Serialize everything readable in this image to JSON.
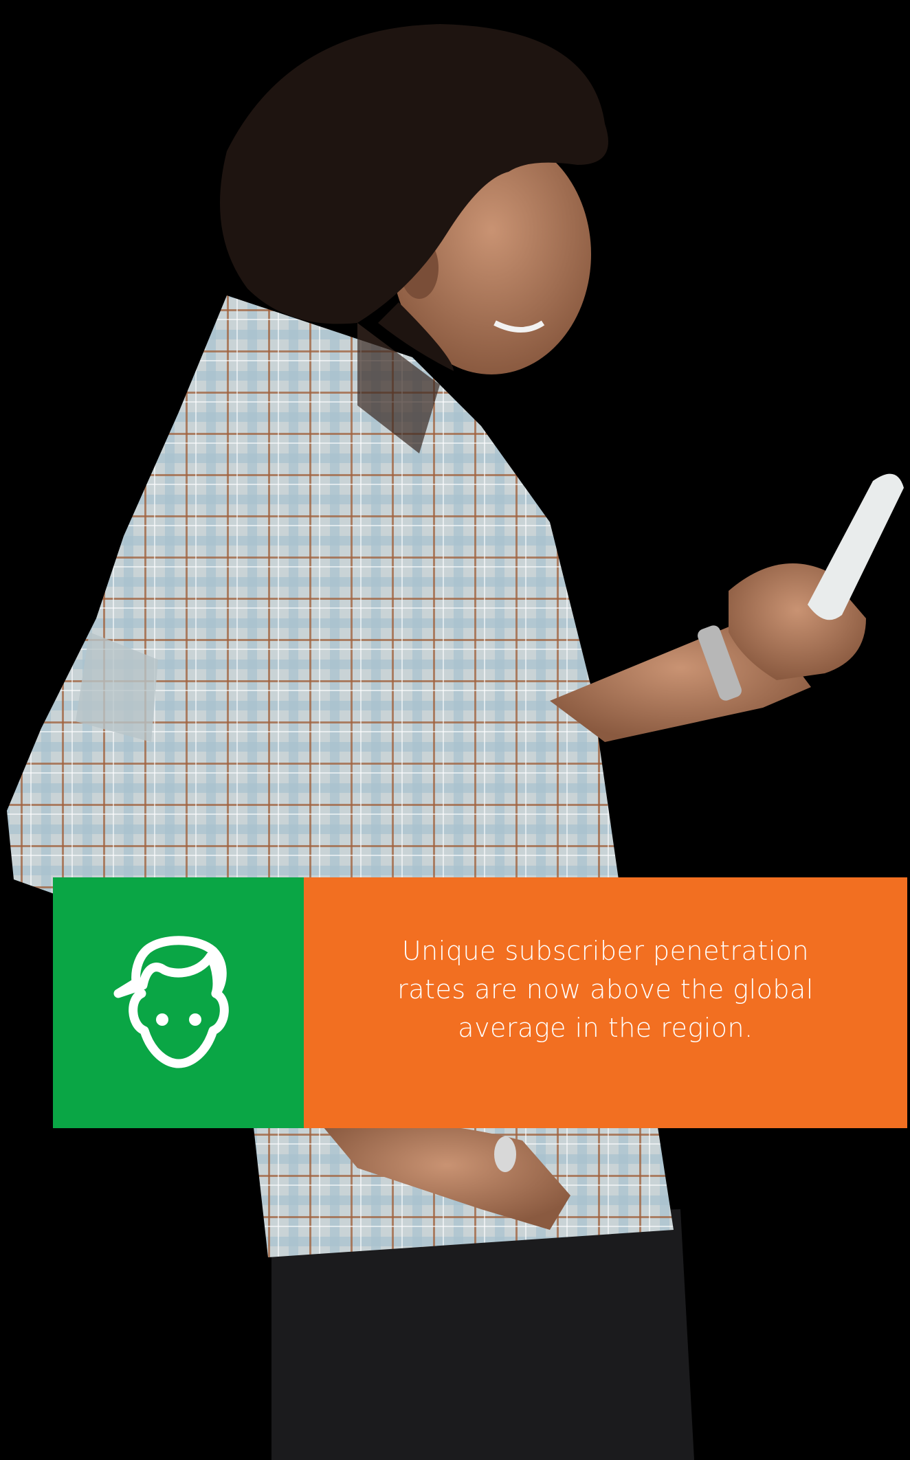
{
  "colors": {
    "background": "#000000",
    "icon_panel": "#0aa645",
    "text_panel": "#f26f21",
    "text": "#ffffff"
  },
  "icon": "person-face-icon",
  "caption": "Unique subscriber penetration rates are now above the global average in the region."
}
